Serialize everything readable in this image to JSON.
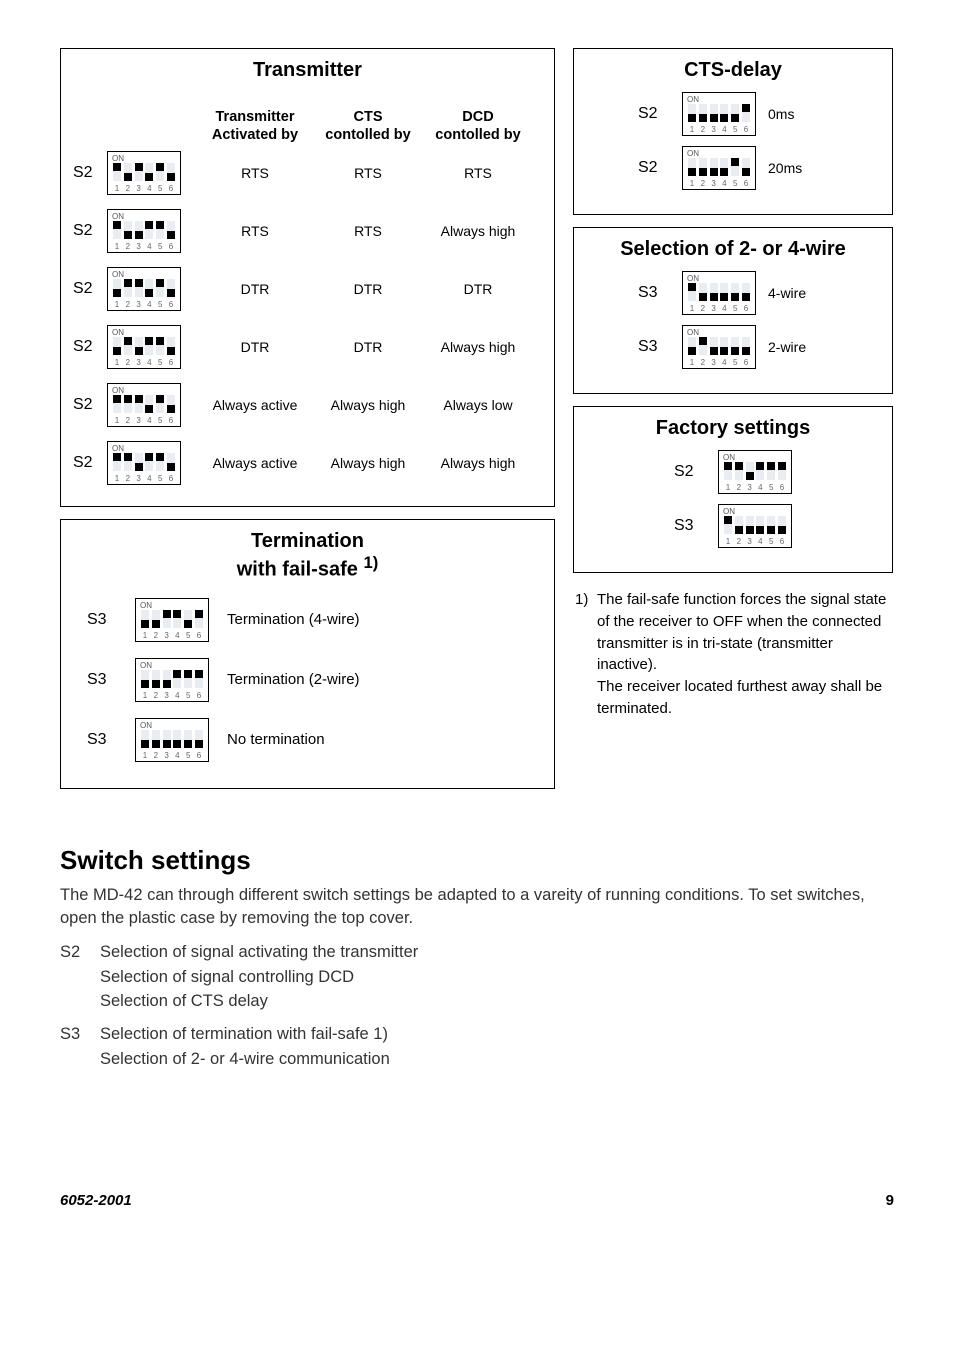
{
  "transmitter": {
    "title": "Transmitter",
    "head": {
      "c1": "Transmitter Activated by",
      "c2": "CTS contolled by",
      "c3": "DCD contolled by"
    },
    "rows": [
      {
        "lab": "S2",
        "dip": [
          1,
          0,
          1,
          0,
          1,
          0
        ],
        "c1": "RTS",
        "c2": "RTS",
        "c3": "RTS"
      },
      {
        "lab": "S2",
        "dip": [
          1,
          0,
          0,
          1,
          1,
          0
        ],
        "c1": "RTS",
        "c2": "RTS",
        "c3": "Always high"
      },
      {
        "lab": "S2",
        "dip": [
          0,
          1,
          1,
          0,
          1,
          0
        ],
        "c1": "DTR",
        "c2": "DTR",
        "c3": "DTR"
      },
      {
        "lab": "S2",
        "dip": [
          0,
          1,
          0,
          1,
          1,
          0
        ],
        "c1": "DTR",
        "c2": "DTR",
        "c3": "Always high"
      },
      {
        "lab": "S2",
        "dip": [
          1,
          1,
          1,
          0,
          1,
          0
        ],
        "c1": "Always active",
        "c2": "Always high",
        "c3": "Always low"
      },
      {
        "lab": "S2",
        "dip": [
          1,
          1,
          0,
          1,
          1,
          0
        ],
        "c1": "Always active",
        "c2": "Always high",
        "c3": "Always high"
      }
    ]
  },
  "termination": {
    "title": "Termination",
    "subtitle": "with fail-safe ",
    "sup": "1)",
    "rows": [
      {
        "lab": "S3",
        "dip": [
          0,
          0,
          1,
          1,
          0,
          1
        ],
        "txt": "Termination (4-wire)"
      },
      {
        "lab": "S3",
        "dip": [
          0,
          0,
          0,
          1,
          1,
          1
        ],
        "txt": "Termination (2-wire)"
      },
      {
        "lab": "S3",
        "dip": [
          0,
          0,
          0,
          0,
          0,
          0
        ],
        "txt": "No termination"
      }
    ]
  },
  "cts": {
    "title": "CTS-delay",
    "rows": [
      {
        "lab": "S2",
        "dip": [
          0,
          0,
          0,
          0,
          0,
          1
        ],
        "txt": "0ms"
      },
      {
        "lab": "S2",
        "dip": [
          0,
          0,
          0,
          0,
          1,
          0
        ],
        "txt": "20ms"
      }
    ]
  },
  "wire": {
    "title": "Selection of 2- or 4-wire",
    "rows": [
      {
        "lab": "S3",
        "dip": [
          1,
          0,
          0,
          0,
          0,
          0
        ],
        "txt": "4-wire"
      },
      {
        "lab": "S3",
        "dip": [
          0,
          1,
          0,
          0,
          0,
          0
        ],
        "txt": "2-wire"
      }
    ]
  },
  "factory": {
    "title": "Factory settings",
    "rows": [
      {
        "lab": "S2",
        "dip": [
          1,
          1,
          0,
          1,
          1,
          1
        ],
        "txt": ""
      },
      {
        "lab": "S3",
        "dip": [
          1,
          0,
          0,
          0,
          0,
          0
        ],
        "txt": ""
      }
    ]
  },
  "footnote": "1) The fail-safe function forces the signal state of the receiver to OFF when the connected transmitter is in tri-state (transmitter inactive).\nThe receiver located furthest away shall be terminated.",
  "section": {
    "title": "Switch settings",
    "para": "The MD-42 can through different switch settings be adapted to a vareity of running conditions. To set switches,  open the plastic case by removing the top cover.",
    "items": [
      {
        "k": "S2",
        "v": "Selection of signal activating the transmitter\nSelection of signal controlling DCD\nSelection of CTS delay"
      },
      {
        "k": "S3",
        "v": "Selection of termination with fail-safe 1)\nSelection of 2- or 4-wire communication"
      }
    ]
  },
  "footer": {
    "left": "6052-2001",
    "right": "9"
  }
}
